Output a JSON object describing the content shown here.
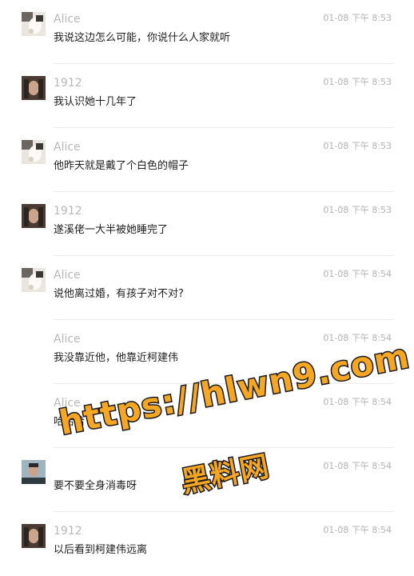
{
  "messages": [
    {
      "avatar": "alice",
      "sender": "Alice",
      "time": "01-08 下午 8:53",
      "text": "我说这边怎么可能，你说什么人家就听"
    },
    {
      "avatar": "1912",
      "sender": "1912",
      "time": "01-08 下午 8:53",
      "text": "我认识她十几年了"
    },
    {
      "avatar": "alice",
      "sender": "Alice",
      "time": "01-08 下午 8:53",
      "text": "他昨天就是戴了个白色的帽子"
    },
    {
      "avatar": "1912",
      "sender": "1912",
      "time": "01-08 下午 8:53",
      "text": "遂溪佬一大半被她睡完了"
    },
    {
      "avatar": "alice",
      "sender": "Alice",
      "time": "01-08 下午 8:54",
      "text": "说他离过婚，有孩子对不对?"
    },
    {
      "avatar": "none",
      "sender": "Alice",
      "time": "01-08 下午 8:54",
      "text": "我没靠近他，他靠近柯建伟"
    },
    {
      "avatar": "none",
      "sender": "Alice",
      "time": "01-08 下午 8:54",
      "text": "哈哈哈"
    },
    {
      "avatar": "man",
      "sender": "",
      "time": "01-08 下午 8:54",
      "text": "要不要全身消毒呀"
    },
    {
      "avatar": "1912",
      "sender": "1912",
      "time": "01-08 下午 8:54",
      "text": "以后看到柯建伟远离"
    }
  ],
  "watermark": {
    "line1": "https://hlwn9.com",
    "line2": "黑料网"
  }
}
